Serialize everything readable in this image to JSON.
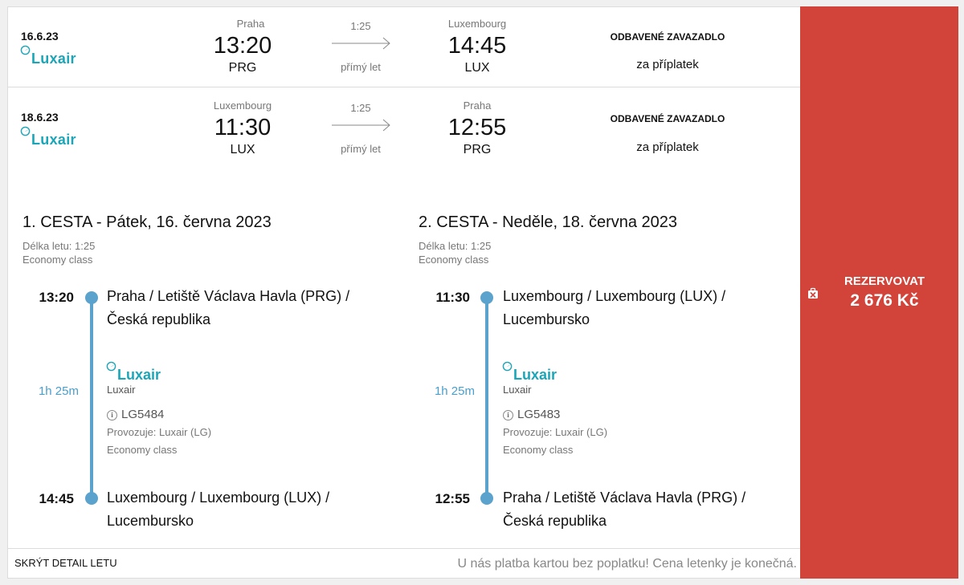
{
  "flights": [
    {
      "date": "16.6.23",
      "airline_logo": "Luxair",
      "from_city": "Praha",
      "dep_time": "13:20",
      "from_code": "PRG",
      "duration": "1:25",
      "type": "přímý let",
      "to_city": "Luxembourg",
      "arr_time": "14:45",
      "to_code": "LUX",
      "baggage_title": "ODBAVENÉ ZAVAZADLO",
      "baggage_value": "za příplatek"
    },
    {
      "date": "18.6.23",
      "airline_logo": "Luxair",
      "from_city": "Luxembourg",
      "dep_time": "11:30",
      "from_code": "LUX",
      "duration": "1:25",
      "type": "přímý let",
      "to_city": "Praha",
      "arr_time": "12:55",
      "to_code": "PRG",
      "baggage_title": "ODBAVENÉ ZAVAZADLO",
      "baggage_value": "za příplatek"
    }
  ],
  "legs": [
    {
      "title": "1. CESTA - Pátek, 16. června 2023",
      "flight_length": "Délka letu: 1:25",
      "class": "Economy class",
      "dep_time": "13:20",
      "dep_place_1": "Praha / Letiště Václava Havla (PRG) /",
      "dep_place_2": "Česká republika",
      "segment_duration": "1h 25m",
      "carrier_logo": "Luxair",
      "carrier_name": "Luxair",
      "flight_no": "LG5484",
      "operated_by": "Provozuje: Luxair (LG)",
      "segment_class": "Economy class",
      "arr_time": "14:45",
      "arr_place_1": "Luxembourg / Luxembourg (LUX) /",
      "arr_place_2": "Lucembursko"
    },
    {
      "title": "2. CESTA - Neděle, 18. června 2023",
      "flight_length": "Délka letu: 1:25",
      "class": "Economy class",
      "dep_time": "11:30",
      "dep_place_1": "Luxembourg / Luxembourg (LUX) /",
      "dep_place_2": "Lucembursko",
      "segment_duration": "1h 25m",
      "carrier_logo": "Luxair",
      "carrier_name": "Luxair",
      "flight_no": "LG5483",
      "operated_by": "Provozuje: Luxair (LG)",
      "segment_class": "Economy class",
      "arr_time": "12:55",
      "arr_place_1": "Praha / Letiště Václava Havla (PRG) /",
      "arr_place_2": "Česká republika"
    }
  ],
  "booking": {
    "label": "REZERVOVAT",
    "price": "2 676 Kč",
    "icon": "no-baggage-icon",
    "color": "#d2433a"
  },
  "footer": {
    "hide_detail": "SKRÝT DETAIL LETU",
    "note": "U nás platba kartou bez poplatku! Cena letenky je konečná."
  }
}
